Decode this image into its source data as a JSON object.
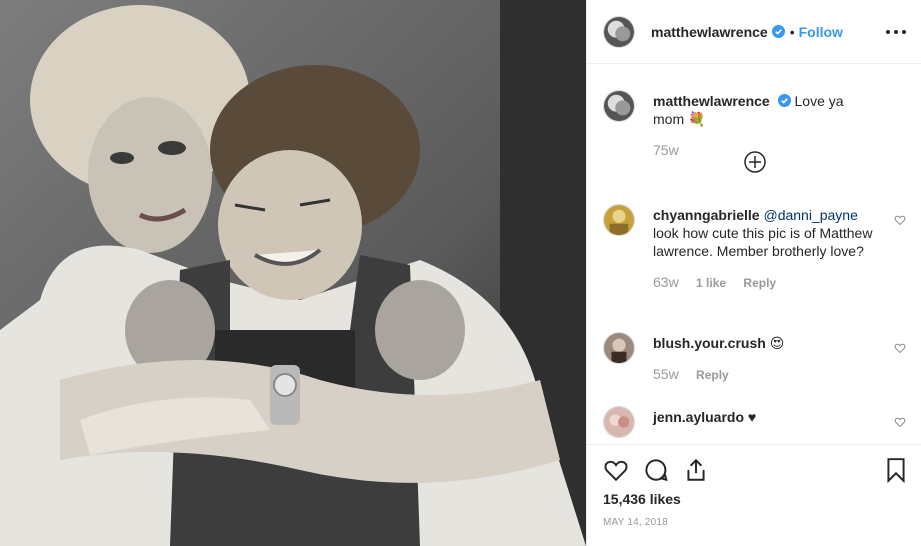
{
  "post": {
    "username": "matthewlawrence",
    "follow_label": "Follow",
    "separator": "•",
    "caption": "Love ya mom",
    "caption_emoji": "💐",
    "caption_age": "75w",
    "likes": "15,436 likes",
    "date": "MAY 14, 2018"
  },
  "comments": [
    {
      "username": "chyanngabrielle",
      "mention": "@danni_payne",
      "text": "look how cute this pic is of Matthew lawrence. Member brotherly love?",
      "age": "63w",
      "likes": "1 like",
      "reply": "Reply"
    },
    {
      "username": "blush.your.crush",
      "text": "😍",
      "age": "55w",
      "reply": "Reply"
    },
    {
      "username": "jenn.ayluardo",
      "text": "♥"
    }
  ],
  "icons": {
    "verified": "verified-badge-icon",
    "more": "more-options-icon",
    "load_more": "load-more-comments-icon",
    "like": "heart-icon",
    "comment": "comment-bubble-icon",
    "share": "share-icon",
    "save": "bookmark-icon"
  },
  "colors": {
    "link_blue": "#3897f0",
    "text": "#262626",
    "muted": "#999999",
    "border": "#efefef"
  }
}
